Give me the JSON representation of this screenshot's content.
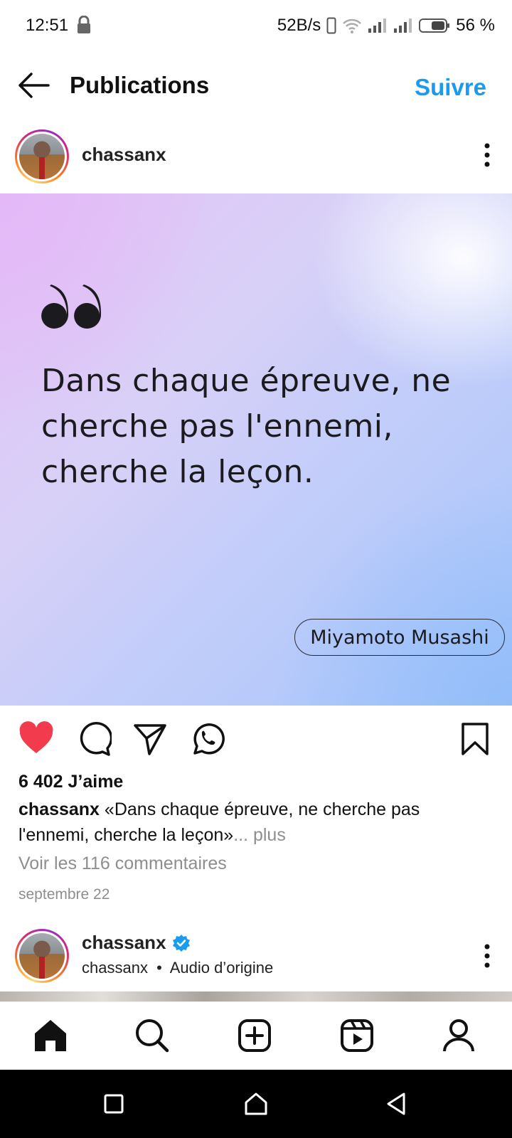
{
  "status_bar": {
    "time": "12:51",
    "network_speed": "52B/s",
    "battery": "56 %"
  },
  "header": {
    "title": "Publications",
    "follow_label": "Suivre"
  },
  "post": {
    "username": "chassanx",
    "image": {
      "quote": "Dans chaque épreuve, ne cherche pas l'ennemi, cherche la leçon.",
      "author": "Miyamoto Musashi"
    },
    "liked": true,
    "likes": "6 402 J’aime",
    "caption_user": "chassanx",
    "caption_text": "«Dans chaque épreuve, ne cherche pas l'ennemi, cherche la leçon»",
    "caption_more": "... plus",
    "view_comments": "Voir les 116 commentaires",
    "date": "septembre 22"
  },
  "next_post": {
    "username": "chassanx",
    "verified": true,
    "sub_user": "chassanx",
    "separator": "•",
    "audio": "Audio d’origine"
  },
  "colors": {
    "accent": "#1a9bf0",
    "like": "#f23b4c",
    "verified": "#1a9bf0"
  },
  "icons": {
    "actions": [
      "heart-icon",
      "comment-icon",
      "share-icon",
      "whatsapp-icon",
      "bookmark-icon"
    ],
    "bottom_nav": [
      "home-icon",
      "search-icon",
      "create-icon",
      "reels-icon",
      "profile-icon"
    ],
    "system_nav": [
      "recents-icon",
      "home-button-icon",
      "back-icon"
    ]
  }
}
